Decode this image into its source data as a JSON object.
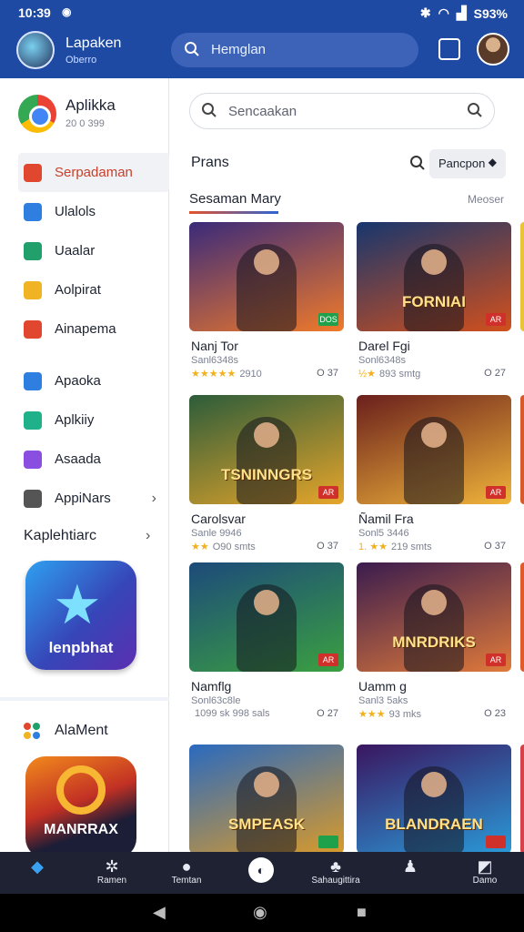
{
  "status_bar": {
    "time": "10:39",
    "battery": "S93%"
  },
  "header": {
    "title": "Lapaken",
    "subtitle": "Oberro",
    "search_text": "Hemglan"
  },
  "sidebar": {
    "brand_name": "Aplikka",
    "brand_sub": "20 0 399",
    "items": [
      {
        "label": "Serpadaman",
        "icon_color": "#e0472e",
        "active": true
      },
      {
        "label": "Ulalols",
        "icon_color": "#2f7fe0"
      },
      {
        "label": "Uaalar",
        "icon_color": "#22a06b"
      },
      {
        "label": "Aolpirat",
        "icon_color": "#f0b323"
      },
      {
        "label": "Ainapema",
        "icon_color": "#e0472e"
      },
      {
        "label": "Apaoka",
        "icon_color": "#2f7fe0"
      },
      {
        "label": "Aplkiiy",
        "icon_color": "#1fb28a"
      },
      {
        "label": "Asaada",
        "icon_color": "#8a4fe0"
      },
      {
        "label": "AppiNars",
        "icon_color": "#555555"
      }
    ],
    "section_title": "Kaplehtiarc",
    "featured_app_label": "lenpbhat",
    "section2_title": "AlaMent",
    "featured_app2_label": "MANRRAX"
  },
  "main": {
    "search_placeholder": "Sencaakan",
    "section_label": "Prans",
    "sort_label": "Pancpon",
    "tab_title": "Sesaman Mary",
    "tab_more": "Meoser",
    "games": [
      {
        "name": "Nanj Tor",
        "dev": "Sanl6348s",
        "stars": "★★★★★",
        "meta": "2910",
        "downloads": "O 37",
        "art_from": "#3a2a7a",
        "art_to": "#f07a2a",
        "logo": "",
        "badge_color": "#1fa04a",
        "badge": "DOS"
      },
      {
        "name": "Darel Fgi",
        "dev": "Sonl6348s",
        "stars": "½★",
        "meta": "893 smtg",
        "downloads": "O 27",
        "art_from": "#17366e",
        "art_to": "#d2501c",
        "logo": "FORNIAI",
        "badge_color": "#d0302a",
        "badge": "AR"
      },
      {
        "name": "Carolsvar",
        "dev": "Sanle 9946",
        "stars": "★★",
        "meta": "O90 smts",
        "downloads": "O 37",
        "art_from": "#2c5c3a",
        "art_to": "#e6a52a",
        "logo": "TSNINNGRS",
        "badge_color": "#d0302a",
        "badge": "AR"
      },
      {
        "name": "Ñamil Fra",
        "dev": "Sonl5 3446",
        "stars": "1. ★★",
        "meta": "219 smts",
        "downloads": "O 37",
        "art_from": "#6a1f1c",
        "art_to": "#f0b43a",
        "logo": "",
        "badge_color": "#d0302a",
        "badge": "AR"
      },
      {
        "name": "Namflg",
        "dev": "Sonl63c8le",
        "stars": "",
        "meta": "1099 sk 998 sals",
        "downloads": "O 27",
        "art_from": "#1d4a7a",
        "art_to": "#3aa040",
        "logo": "",
        "badge_color": "#d0302a",
        "badge": "AR"
      },
      {
        "name": "Uamm g",
        "dev": "Sanl3 5aks",
        "stars": "★★★",
        "meta": "93 mks",
        "downloads": "O 23",
        "art_from": "#3a1c4e",
        "art_to": "#e07a3a",
        "logo": "MNRDRIKS",
        "badge_color": "#d0302a",
        "badge": "AR"
      },
      {
        "name": "",
        "dev": "",
        "stars": "",
        "meta": "",
        "downloads": "",
        "art_from": "#2a6abf",
        "art_to": "#d99a2a",
        "logo": "SMPEASK",
        "badge_color": "#1fa04a",
        "badge": ""
      },
      {
        "name": "",
        "dev": "",
        "stars": "",
        "meta": "",
        "downloads": "",
        "art_from": "#3a1660",
        "art_to": "#2a9ad8",
        "logo": "BLANDRAEN",
        "badge_color": "#d0302a",
        "badge": ""
      }
    ]
  },
  "bottom_nav": [
    {
      "label": "",
      "glyph": "◆"
    },
    {
      "label": "Ramen",
      "glyph": "✲"
    },
    {
      "label": "Temtan",
      "glyph": "●"
    },
    {
      "label": "",
      "glyph": "◐"
    },
    {
      "label": "Sahaugittira",
      "glyph": "♣"
    },
    {
      "label": "",
      "glyph": "♟"
    },
    {
      "label": "Damo",
      "glyph": "◩"
    }
  ]
}
